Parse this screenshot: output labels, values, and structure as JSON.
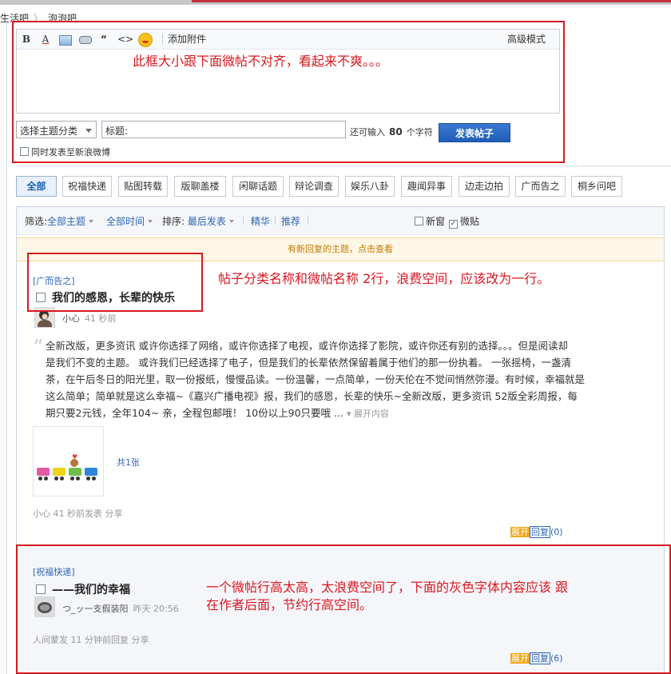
{
  "breadcrumb": {
    "items": [
      "生活吧",
      "泡泡吧"
    ]
  },
  "editor": {
    "toolbar": {
      "bold": "B",
      "font_color": "A",
      "quote": "“",
      "code": "<>",
      "attach": "添加附件",
      "advanced": "高级模式"
    },
    "category_select": "选择主题分类",
    "title_placeholder": "标题:",
    "remaining_prefix": "还可输入",
    "remaining_count": "80",
    "remaining_suffix": "个字符",
    "submit_label": "发表帖子",
    "sync_label": "同时发表至新浪微博"
  },
  "annotations": {
    "editor_note": "此框大小跟下面微帖不对齐，看起来不爽。。。",
    "category_note": "帖子分类名称和微帖名称 2行，浪费空间，应该改为一行。",
    "height_note_line1": "一个微帖行高太高，太浪费空间了，下面的灰色字体内容应该 跟",
    "height_note_line2": "在作者后面，节约行高空间。"
  },
  "tabs": [
    "全部",
    "祝福快递",
    "贴图转载",
    "版聊盖楼",
    "闲聊话题",
    "辩论调查",
    "娱乐八卦",
    "趣闻异事",
    "边走边拍",
    "广而告之",
    "桐乡问吧"
  ],
  "filter": {
    "label": "筛选:",
    "topic": "全部主题",
    "time": "全部时间",
    "sort_label": "排序:",
    "sort": "最后发表",
    "digest": "精华",
    "recommend": "推荐",
    "new_window": "新窗",
    "micro_post": "微贴"
  },
  "new_replies": "有新回复的主题，点击查看",
  "posts": [
    {
      "category": "[广而告之]",
      "title": "我们的感恩，长辈的快乐",
      "author": "小心",
      "time": "41 秒前",
      "content_lines": [
        "全新改版，更多资讯 或许你选择了网络，或许你选择了电视，或许你选择了影院，或许你还有别的选择。。。但是阅读却",
        "是我们不变的主题。 或许我们已经选择了电子，但是我们的长辈依然保留着属于他们的那一份执着。 一张摇椅，一盏清",
        "茶，在午后冬日的阳光里，取一份报纸，慢慢品读。一份温馨，一点简单，一份天伦在不觉间悄然弥漫。有时候，幸福就是",
        "这么简单；简单就是这么幸福~《嘉兴广播电视》报，我们的感恩，长辈的快乐~全新改版，更多资讯 52版全彩周报，每",
        "期只要2元钱，全年104~ 亲，全程包邮哦！ 10份以上90只要哦 ..."
      ],
      "expand_content": "展开内容",
      "image_count": "共1张",
      "meta": "小心  41 秒前发表  分享",
      "reply_expand": "展开",
      "reply_label": "回复",
      "reply_count": "(0)"
    },
    {
      "category": "[祝福快递]",
      "title": "——我们的幸福",
      "author": "つ_ッ一支假装阳",
      "time": "昨天 20:56",
      "meta": "人间蒙发  11 分钟前回复  分享",
      "reply_expand": "展开",
      "reply_label": "回复",
      "reply_count": "(6)"
    }
  ],
  "colors": {
    "annotation_red": "#d71920",
    "link_blue": "#2d64b3",
    "submit_blue": "#1f5db8"
  }
}
